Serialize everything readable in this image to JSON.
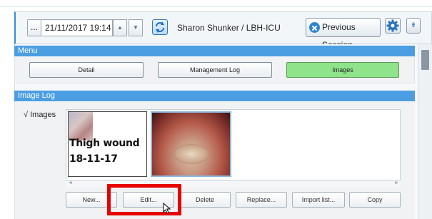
{
  "header": {
    "ellipsis_label": "...",
    "datetime": "21/11/2017 19:14",
    "spin_up": "▲",
    "spin_down": "▼",
    "patient": "Sharon Shunker / LBH-ICU",
    "previous_session_label": "Previous Session",
    "collapse_glyph": "⇟"
  },
  "menu": {
    "title": "Menu",
    "items": [
      {
        "label": "Detail",
        "active": false
      },
      {
        "label": "Management Log",
        "active": false
      },
      {
        "label": "Images",
        "active": true
      }
    ],
    "active_color": "#8fe38a"
  },
  "image_log": {
    "title": "Image Log",
    "folder_label": "√ Images",
    "thumb1_caption_line1": "Thigh wound",
    "thumb1_caption_line2": "18-11-17",
    "scroll_left": "◄",
    "scroll_right": "►",
    "actions": [
      "New...",
      "Edit...",
      "Delete",
      "Replace...",
      "Import list...",
      "Copy"
    ]
  },
  "colors": {
    "section_header": "#4b9ee2",
    "highlight": "#e60000"
  }
}
